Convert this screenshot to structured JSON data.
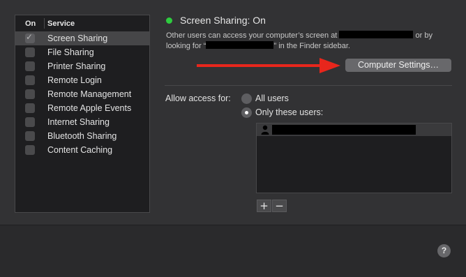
{
  "services": {
    "header_on": "On",
    "header_service": "Service",
    "items": [
      {
        "label": "Screen Sharing",
        "checked": true,
        "selected": true
      },
      {
        "label": "File Sharing",
        "checked": false,
        "selected": false
      },
      {
        "label": "Printer Sharing",
        "checked": false,
        "selected": false
      },
      {
        "label": "Remote Login",
        "checked": false,
        "selected": false
      },
      {
        "label": "Remote Management",
        "checked": false,
        "selected": false
      },
      {
        "label": "Remote Apple Events",
        "checked": false,
        "selected": false
      },
      {
        "label": "Internet Sharing",
        "checked": false,
        "selected": false
      },
      {
        "label": "Bluetooth Sharing",
        "checked": false,
        "selected": false
      },
      {
        "label": "Content Caching",
        "checked": false,
        "selected": false
      }
    ]
  },
  "status": {
    "title": "Screen Sharing: On",
    "indicator_color": "#2ecc3f",
    "desc_part1": "Other users can access your computer’s screen at ",
    "desc_part2": " or by",
    "desc_part3": "looking for “",
    "desc_part4": "” in the Finder sidebar."
  },
  "buttons": {
    "computer_settings": "Computer Settings…",
    "add": "+",
    "remove": "−",
    "help": "?"
  },
  "access": {
    "label": "Allow access for:",
    "option_all": "All users",
    "option_only": "Only these users:",
    "selected": "only"
  },
  "users": [
    {
      "icon": "user-silhouette-icon",
      "name": ""
    }
  ],
  "annotation": {
    "arrow_color": "#e8261c"
  }
}
